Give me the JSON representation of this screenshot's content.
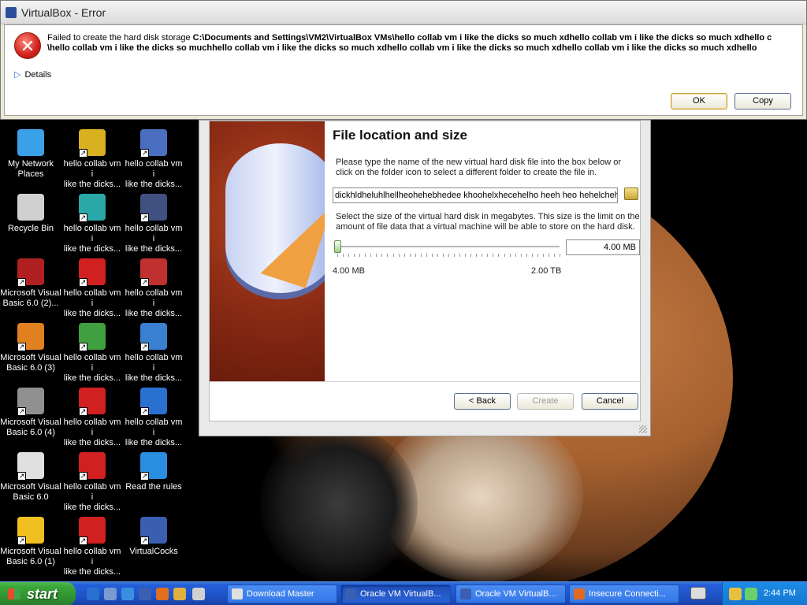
{
  "error_dialog": {
    "title": "VirtualBox - Error",
    "message_prefix": "Failed to create the hard disk storage ",
    "message_path_line1": "C:\\Documents and Settings\\VM2\\VirtualBox VMs\\hello collab vm i like the dicks so much xdhello collab vm i like the dicks so much xdhello c",
    "message_path_line2": "\\hello collab vm i like the dicks so muchhello collab vm i like the dicks so much xdhello collab vm i like the dicks so much xdhello collab vm i like the dicks so much xdhello",
    "details_label": "Details",
    "ok_label": "OK",
    "copy_label": "Copy"
  },
  "wizard": {
    "heading": "File location and size",
    "instruction1": "Please type the name of the new virtual hard disk file into the box below or click on the folder icon to select a different folder to create the file in.",
    "file_value": "dickhldheluhlhellheohehebhedee khoohelxhecehelho heeh heo hehelchehe",
    "instruction2": "Select the size of the virtual hard disk in megabytes. This size is the limit on the amount of file data that a virtual machine will be able to store on the hard disk.",
    "size_value": "4.00 MB",
    "min_label": "4.00 MB",
    "max_label": "2.00 TB",
    "slider_position": 0,
    "back_label": "< Back",
    "create_label": "Create",
    "cancel_label": "Cancel"
  },
  "desktop_icons": [
    {
      "name": "my-network-places-icon",
      "label1": "My Network",
      "label2": "Places",
      "color": "#3aa0e8"
    },
    {
      "name": "smb-icon",
      "label1": "hello collab vm i",
      "label2": "like the dicks...",
      "color": "#d8b020"
    },
    {
      "name": "film-icon",
      "label1": "hello collab vm i",
      "label2": "like the dicks...",
      "color": "#4a6fc0"
    },
    {
      "name": "recycle-bin-icon",
      "label1": "Recycle Bin",
      "label2": "",
      "color": "#d0d0d0"
    },
    {
      "name": "puzzle-icon",
      "label1": "hello collab vm i",
      "label2": "like the dicks...",
      "color": "#2aa8a8"
    },
    {
      "name": "galaxy-icon",
      "label1": "hello collab vm i",
      "label2": "like the dicks...",
      "color": "#405080"
    },
    {
      "name": "vb6-icon",
      "label1": "Microsoft Visual",
      "label2": "Basic 6.0 (2)...",
      "color": "#b02020"
    },
    {
      "name": "mario-icon",
      "label1": "hello collab vm i",
      "label2": "like the dicks...",
      "color": "#d02020"
    },
    {
      "name": "dark-c-icon",
      "label1": "hello collab vm i",
      "label2": "like the dicks...",
      "color": "#c03030"
    },
    {
      "name": "vb6-blocks-icon",
      "label1": "Microsoft Visual",
      "label2": "Basic 6.0 (3)",
      "color": "#e08020"
    },
    {
      "name": "soccer-icon",
      "label1": "hello collab vm i",
      "label2": "like the dicks...",
      "color": "#40a040"
    },
    {
      "name": "qbittorrent-icon",
      "label1": "hello collab vm i",
      "label2": "like the dicks...",
      "color": "#3a80d0"
    },
    {
      "name": "raccoon-icon",
      "label1": "Microsoft Visual",
      "label2": "Basic 6.0 (4)",
      "color": "#909090"
    },
    {
      "name": "mario2-icon",
      "label1": "hello collab vm i",
      "label2": "like the dicks...",
      "color": "#d02020"
    },
    {
      "name": "quicktime-icon",
      "label1": "hello collab vm i",
      "label2": "like the dicks...",
      "color": "#2a70d0"
    },
    {
      "name": "gamepad-icon",
      "label1": "Microsoft Visual",
      "label2": "Basic 6.0",
      "color": "#e0e0e0"
    },
    {
      "name": "mario3-icon",
      "label1": "hello collab vm i",
      "label2": "like the dicks...",
      "color": "#d02020"
    },
    {
      "name": "teamviewer-icon",
      "label1": "Read the rules",
      "label2": "",
      "color": "#2a8ee0"
    },
    {
      "name": "sun-icon",
      "label1": "Microsoft Visual",
      "label2": "Basic 6.0 (1)",
      "color": "#f0c020"
    },
    {
      "name": "mario4-icon",
      "label1": "hello collab vm i",
      "label2": "like the dicks...",
      "color": "#d02020"
    },
    {
      "name": "virtualbox-icon",
      "label1": "VirtualCocks",
      "label2": "",
      "color": "#3a5fb0"
    }
  ],
  "taskbar": {
    "start_label": "start",
    "tasks": [
      {
        "label": "Download Master",
        "active": false,
        "icon_color": "#e0e0e0"
      },
      {
        "label": "Oracle VM VirtualB...",
        "active": true,
        "icon_color": "#3a5fb0"
      },
      {
        "label": "Oracle VM VirtualB...",
        "active": false,
        "icon_color": "#3a5fb0"
      },
      {
        "label": "Insecure Connecti...",
        "active": false,
        "icon_color": "#e06a20"
      }
    ],
    "clock": "2:44 PM"
  }
}
